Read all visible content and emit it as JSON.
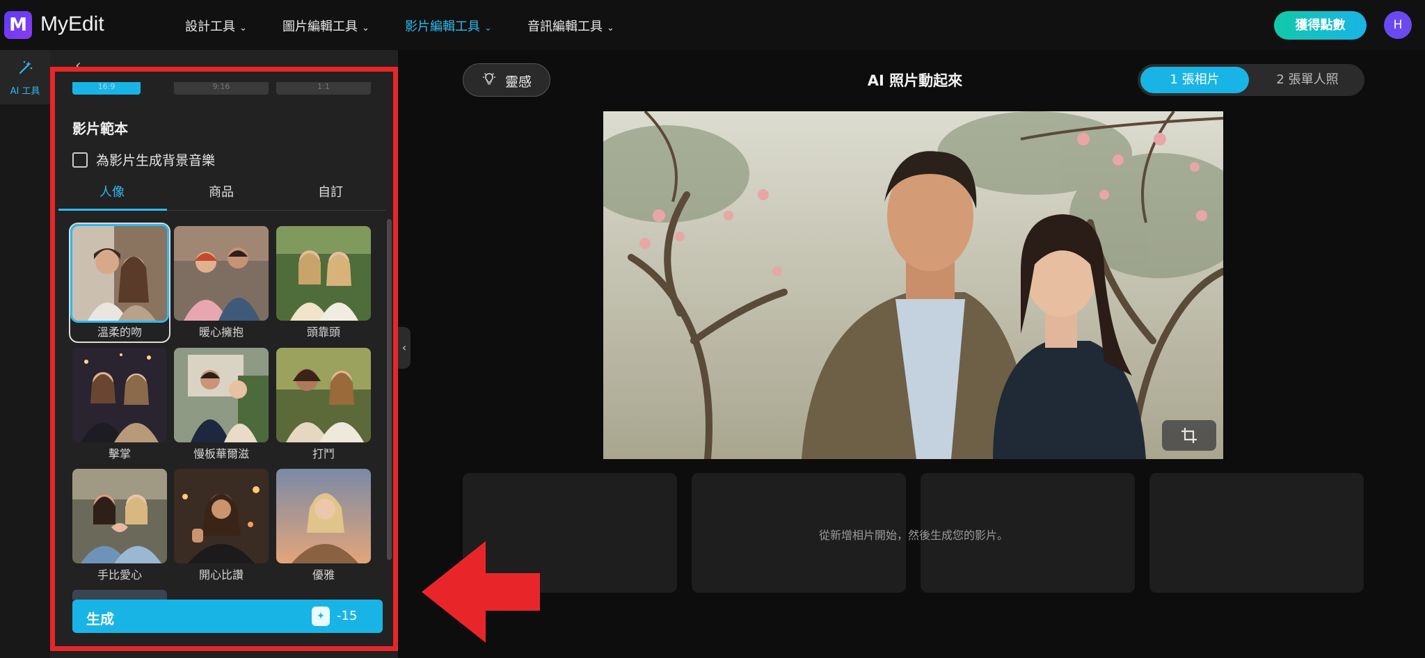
{
  "app": {
    "logo_glyph": "M",
    "name": "MyEdit"
  },
  "nav": [
    {
      "label": "設計工具",
      "active": false
    },
    {
      "label": "圖片編輯工具",
      "active": false
    },
    {
      "label": "影片編輯工具",
      "active": true
    },
    {
      "label": "音訊編輯工具",
      "active": false
    }
  ],
  "header": {
    "points_button": "獲得點數",
    "avatar_initial": "H"
  },
  "rail": {
    "item_label": "AI 工具",
    "icon": "magic-wand-icon"
  },
  "panel": {
    "ratios": [
      "16:9",
      "9:16",
      "1:1"
    ],
    "section_title": "影片範本",
    "bg_music_checkbox": "為影片生成背景音樂",
    "bg_music_checked": false,
    "tabs": [
      "人像",
      "商品",
      "自訂"
    ],
    "active_tab": "人像",
    "templates": [
      {
        "label": "溫柔的吻",
        "selected": true
      },
      {
        "label": "暖心擁抱",
        "selected": false
      },
      {
        "label": "頭靠頭",
        "selected": false
      },
      {
        "label": "擊掌",
        "selected": false
      },
      {
        "label": "慢板華爾滋",
        "selected": false
      },
      {
        "label": "打鬥",
        "selected": false
      },
      {
        "label": "手比愛心",
        "selected": false
      },
      {
        "label": "開心比讚",
        "selected": false
      },
      {
        "label": "優雅",
        "selected": false
      }
    ],
    "generate": {
      "label": "生成",
      "cost": "-15"
    }
  },
  "main": {
    "inspiration_button": "靈感",
    "title": "AI 照片動起來",
    "mode_tabs": [
      "1 張相片",
      "2 張單人照"
    ],
    "active_mode": "1 張相片",
    "empty_message": "從新增相片開始，然後生成您的影片。"
  },
  "colors": {
    "accent": "#19b4e6",
    "highlight_red": "#e8262a",
    "points_gradient": [
      "#12c9a9",
      "#19b4e6"
    ]
  }
}
